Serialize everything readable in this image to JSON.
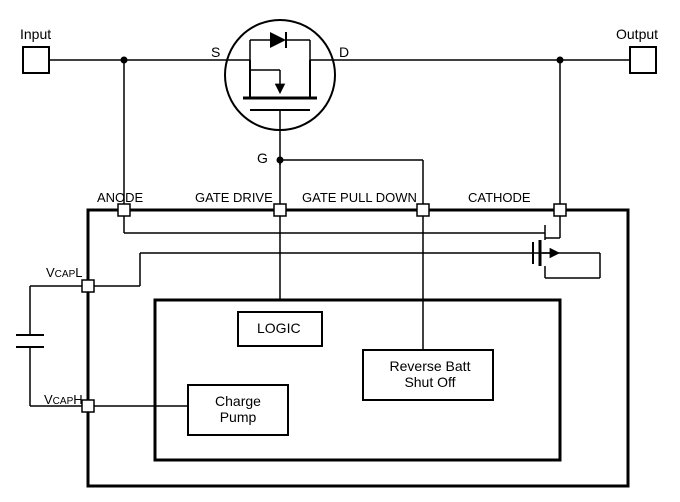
{
  "io": {
    "input": "Input",
    "output": "Output"
  },
  "mosfet": {
    "s": "S",
    "d": "D",
    "g": "G"
  },
  "pins": {
    "anode": "ANODE",
    "gate_drive": "GATE DRIVE",
    "gate_pull_down": "GATE PULL DOWN",
    "cathode": "CATHODE",
    "vcapl_prefix": "V",
    "vcapl_sub": "CAP",
    "vcapl_suffix": "L",
    "vcaph_prefix": "V",
    "vcaph_sub": "CAP",
    "vcaph_suffix": "H"
  },
  "blocks": {
    "logic": "LOGIC",
    "charge_pump": "Charge\nPump",
    "rev_batt": "Reverse Batt\nShut Off"
  }
}
